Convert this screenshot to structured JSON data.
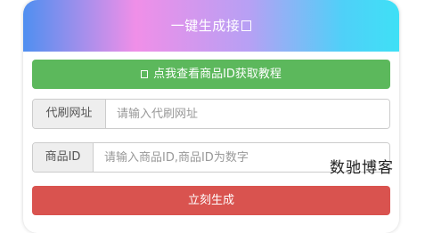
{
  "header": {
    "title": "一键生成接",
    "title_icon": "placeholder-box-icon",
    "gradient": [
      "#4f8ff0",
      "#f08fe8",
      "#b7a0f4",
      "#3fe0f6"
    ]
  },
  "tutorial_button": {
    "icon": "info-box-icon",
    "label": "点我查看商品ID获取教程",
    "color": "#5cb85c"
  },
  "proxy_url": {
    "label": "代刷网址",
    "value": "",
    "placeholder": "请输入代刷网址"
  },
  "product_id": {
    "label": "商品ID",
    "value": "",
    "placeholder": "请输入商品ID,商品ID为数字"
  },
  "generate_button": {
    "label": "立刻生成",
    "color": "#d9534f"
  },
  "watermark": {
    "text": "数驰博客"
  }
}
